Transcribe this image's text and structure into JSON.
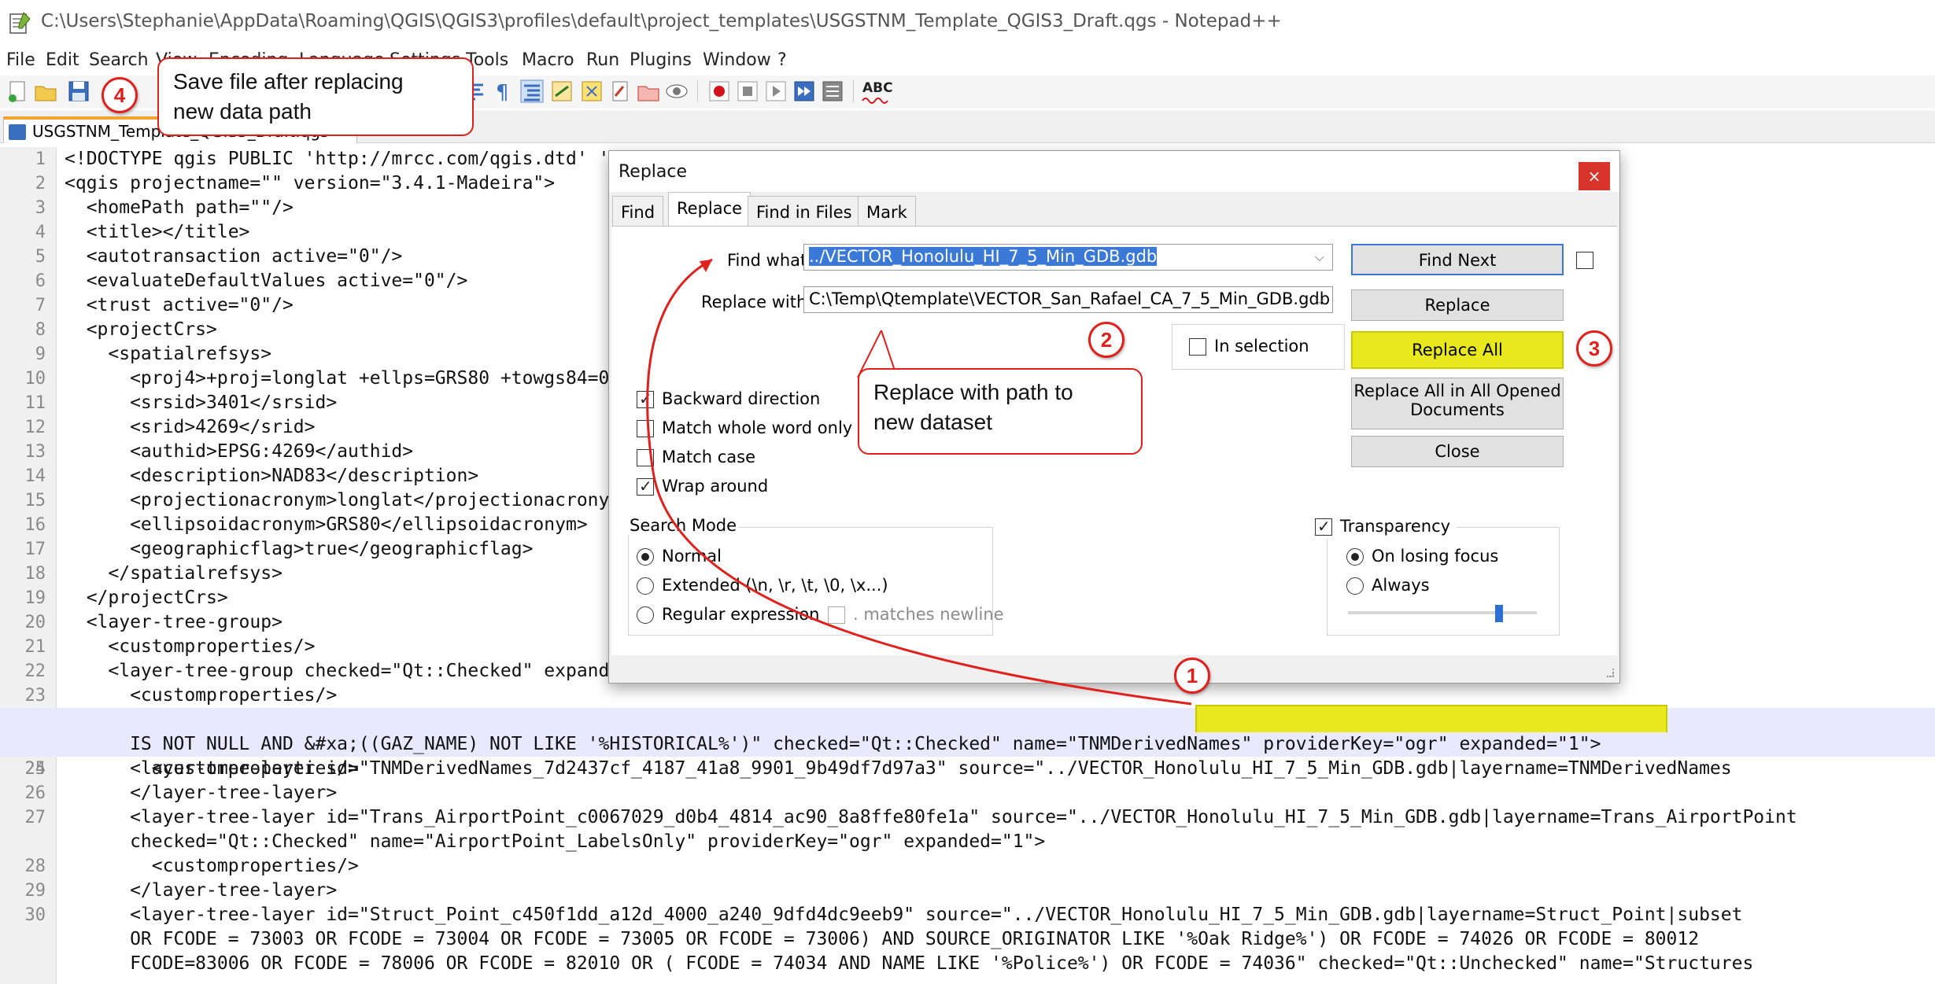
{
  "window": {
    "title": "C:\\Users\\Stephanie\\AppData\\Roaming\\QGIS\\QGIS3\\profiles\\default\\project_templates\\USGSTNM_Template_QGIS3_Draft.qgs - Notepad++"
  },
  "menu": [
    "File",
    "Edit",
    "Search",
    "View",
    "Encoding",
    "Language",
    "Settings",
    "Tools",
    "Macro",
    "Run",
    "Plugins",
    "Window",
    "?"
  ],
  "toolbar": {
    "icons": [
      "new-file-icon",
      "open-file-icon",
      "save-icon",
      "save-all-icon",
      "close-icon",
      "close-all-icon",
      "print-icon",
      "cut-icon",
      "copy-icon",
      "paste-icon",
      "undo-icon",
      "redo-icon",
      "find-icon",
      "replace-icon",
      "zoom-in-icon",
      "zoom-out-icon",
      "sync-v-icon",
      "sync-h-icon",
      "wrap-icon",
      "show-all-chars-icon",
      "indent-guide-icon",
      "udl-icon",
      "doc-map-icon",
      "function-list-icon",
      "folder-workspace-icon",
      "monitoring-icon",
      "record-macro-icon",
      "stop-macro-icon",
      "play-macro-icon",
      "run-macro-multiple-icon",
      "save-macro-icon",
      "spell-check-icon"
    ],
    "spellcheck_label": "ABC"
  },
  "tab": {
    "label": "USGSTNM_Template_QGIS3_Draft.qgs"
  },
  "editor": {
    "lines": [
      {
        "n": "1",
        "text": "<!DOCTYPE qgis PUBLIC 'http://mrcc.com/qgis.dtd' 'SYSTEM'>"
      },
      {
        "n": "2",
        "text": "<qgis projectname=\"\" version=\"3.4.1-Madeira\">"
      },
      {
        "n": "3",
        "text": "  <homePath path=\"\"/>"
      },
      {
        "n": "4",
        "text": "  <title></title>"
      },
      {
        "n": "5",
        "text": "  <autotransaction active=\"0\"/>"
      },
      {
        "n": "6",
        "text": "  <evaluateDefaultValues active=\"0\"/>"
      },
      {
        "n": "7",
        "text": "  <trust active=\"0\"/>"
      },
      {
        "n": "8",
        "text": "  <projectCrs>"
      },
      {
        "n": "9",
        "text": "    <spatialrefsys>"
      },
      {
        "n": "10",
        "text": "      <proj4>+proj=longlat +ellps=GRS80 +towgs84=0,0,0,0,0,0,0 +no_defs</proj4>"
      },
      {
        "n": "11",
        "text": "      <srsid>3401</srsid>"
      },
      {
        "n": "12",
        "text": "      <srid>4269</srid>"
      },
      {
        "n": "13",
        "text": "      <authid>EPSG:4269</authid>"
      },
      {
        "n": "14",
        "text": "      <description>NAD83</description>"
      },
      {
        "n": "15",
        "text": "      <projectionacronym>longlat</projectionacronym>"
      },
      {
        "n": "16",
        "text": "      <ellipsoidacronym>GRS80</ellipsoidacronym>"
      },
      {
        "n": "17",
        "text": "      <geographicflag>true</geographicflag>"
      },
      {
        "n": "18",
        "text": "    </spatialrefsys>"
      },
      {
        "n": "19",
        "text": "  </projectCrs>"
      },
      {
        "n": "20",
        "text": "  <layer-tree-group>"
      },
      {
        "n": "21",
        "text": "    <customproperties/>"
      },
      {
        "n": "22",
        "text": "    <layer-tree-group checked=\"Qt::Checked\" expanded=\"1\" name=\"Transportation\">"
      },
      {
        "n": "23",
        "text": "      <customproperties/>"
      },
      {
        "n": "24",
        "text": "      <layer-tree-layer id=\"TNMDerivedNames_7d2437cf_4187_41a8_9901_9b49df7d97a3\" source=\"../VECTOR_Honolulu_HI_7_5_Min_GDB.gdb|layername=TNMDerivedNames"
      },
      {
        "n": "",
        "text": "      IS NOT NULL AND &#xa;((GAZ_NAME) NOT LIKE '%HISTORICAL%')\" checked=\"Qt::Checked\" name=\"TNMDerivedNames\" providerKey=\"ogr\" expanded=\"1\">"
      },
      {
        "n": "25",
        "text": "        <customproperties/>"
      },
      {
        "n": "26",
        "text": "      </layer-tree-layer>"
      },
      {
        "n": "27",
        "text": "      <layer-tree-layer id=\"Trans_AirportPoint_c0067029_d0b4_4814_ac90_8a8ffe80fe1a\" source=\"../VECTOR_Honolulu_HI_7_5_Min_GDB.gdb|layername=Trans_AirportPoint"
      },
      {
        "n": "",
        "text": "      checked=\"Qt::Checked\" name=\"AirportPoint_LabelsOnly\" providerKey=\"ogr\" expanded=\"1\">"
      },
      {
        "n": "28",
        "text": "        <customproperties/>"
      },
      {
        "n": "29",
        "text": "      </layer-tree-layer>"
      },
      {
        "n": "30",
        "text": "      <layer-tree-layer id=\"Struct_Point_c450f1dd_a12d_4000_a240_9dfd4dc9eeb9\" source=\"../VECTOR_Honolulu_HI_7_5_Min_GDB.gdb|layername=Struct_Point|subset"
      },
      {
        "n": "",
        "text": "      OR FCODE = 73003 OR FCODE = 73004 OR FCODE = 73005 OR FCODE = 73006) AND SOURCE_ORIGINATOR LIKE '%Oak Ridge%') OR FCODE = 74026 OR FCODE = 80012"
      },
      {
        "n": "",
        "text": "      FCODE=83006 OR FCODE = 78006 OR FCODE = 82010 OR ( FCODE = 74034 AND NAME LIKE '%Police%') OR FCODE = 74036\" checked=\"Qt::Unchecked\" name=\"Structures"
      }
    ]
  },
  "dialog": {
    "title": "Replace",
    "close_label": "×",
    "tabs": [
      "Find",
      "Replace",
      "Find in Files",
      "Mark"
    ],
    "find_label": "Find what :",
    "find_value": "../VECTOR_Honolulu_HI_7_5_Min_GDB.gdb",
    "replace_label": "Replace with :",
    "replace_value": "C:\\Temp\\Qtemplate\\VECTOR_San_Rafael_CA_7_5_Min_GDB.gdb",
    "buttons": {
      "find_next": "Find Next",
      "replace": "Replace",
      "replace_all": "Replace All",
      "replace_all_opened": [
        "Replace All in All Opened",
        "Documents"
      ],
      "close": "Close"
    },
    "in_selection": "In selection",
    "options": [
      {
        "label": "Backward direction",
        "checked": true
      },
      {
        "label": "Match whole word only",
        "checked": false
      },
      {
        "label": "Match case",
        "checked": false
      },
      {
        "label": "Wrap around",
        "checked": true
      }
    ],
    "search_mode": {
      "title": "Search Mode",
      "modes": [
        "Normal",
        "Extended (\\n, \\r, \\t, \\0, \\x...)",
        "Regular expression"
      ],
      "selected": "Normal",
      "matches_newline": ". matches newline"
    },
    "transparency": {
      "label": "Transparency",
      "checked": true,
      "modes": [
        "On losing focus",
        "Always"
      ],
      "selected": "On losing focus",
      "slider_level": 0.8
    }
  },
  "annotations": {
    "callout_save": [
      "Save file after replacing",
      "new data path"
    ],
    "callout_replace": [
      "Replace with path to",
      "new dataset"
    ],
    "badges": [
      "1",
      "2",
      "3",
      "4"
    ],
    "accent_color": "#e0201c",
    "highlight_color": "#e8e81c"
  }
}
